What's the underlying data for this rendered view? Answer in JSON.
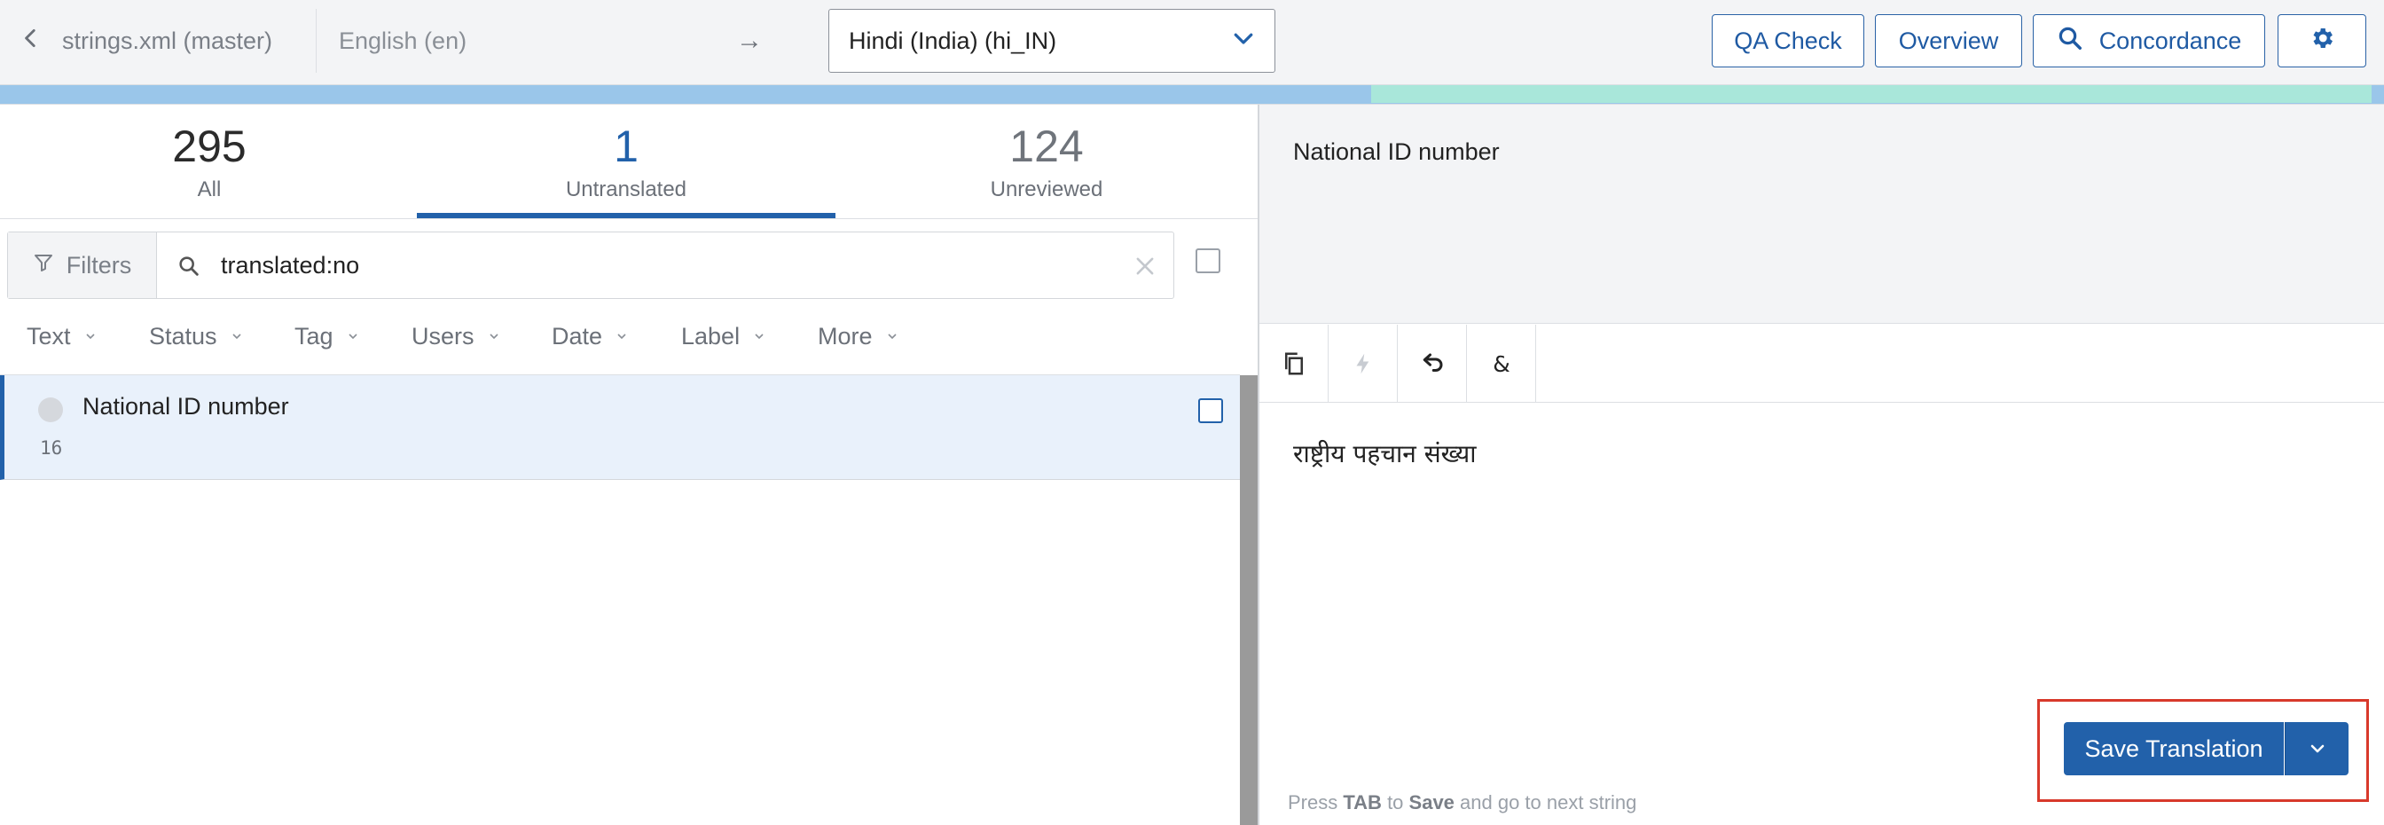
{
  "header": {
    "file_title": "strings.xml (master)",
    "source_language": "English (en)",
    "arrow": "→",
    "target_language": "Hindi (India) (hi_IN)",
    "buttons": {
      "qa_check": "QA Check",
      "overview": "Overview",
      "concordance": "Concordance"
    },
    "icons": [
      "chevron-left-icon",
      "chevron-down-icon",
      "search-icon",
      "gear-icon"
    ]
  },
  "colors": {
    "brand_blue": "#2261aa",
    "progress_blue": "#9ac6ea",
    "progress_green": "#a9e7da",
    "highlight_red": "#d8392b"
  },
  "stats": {
    "all": {
      "count": "295",
      "label": "All"
    },
    "untranslated": {
      "count": "1",
      "label": "Untranslated"
    },
    "unreviewed": {
      "count": "124",
      "label": "Unreviewed"
    }
  },
  "filter": {
    "filters_label": "Filters",
    "search_value": "translated:no"
  },
  "facets": [
    "Text",
    "Status",
    "Tag",
    "Users",
    "Date",
    "Label",
    "More"
  ],
  "strings": [
    {
      "text": "National ID number",
      "id": "16"
    }
  ],
  "editor": {
    "source_text": "National ID number",
    "target_text": "राष्ट्रीय पहचान संख्या",
    "toolbar_icons": [
      "copy-source-icon",
      "lightning-icon",
      "undo-icon",
      "ampersand-icon"
    ],
    "save_label": "Save Translation",
    "hint": {
      "pre": "Press ",
      "key": "TAB",
      "mid": " to ",
      "action": "Save",
      "post": " and go to next string"
    }
  }
}
